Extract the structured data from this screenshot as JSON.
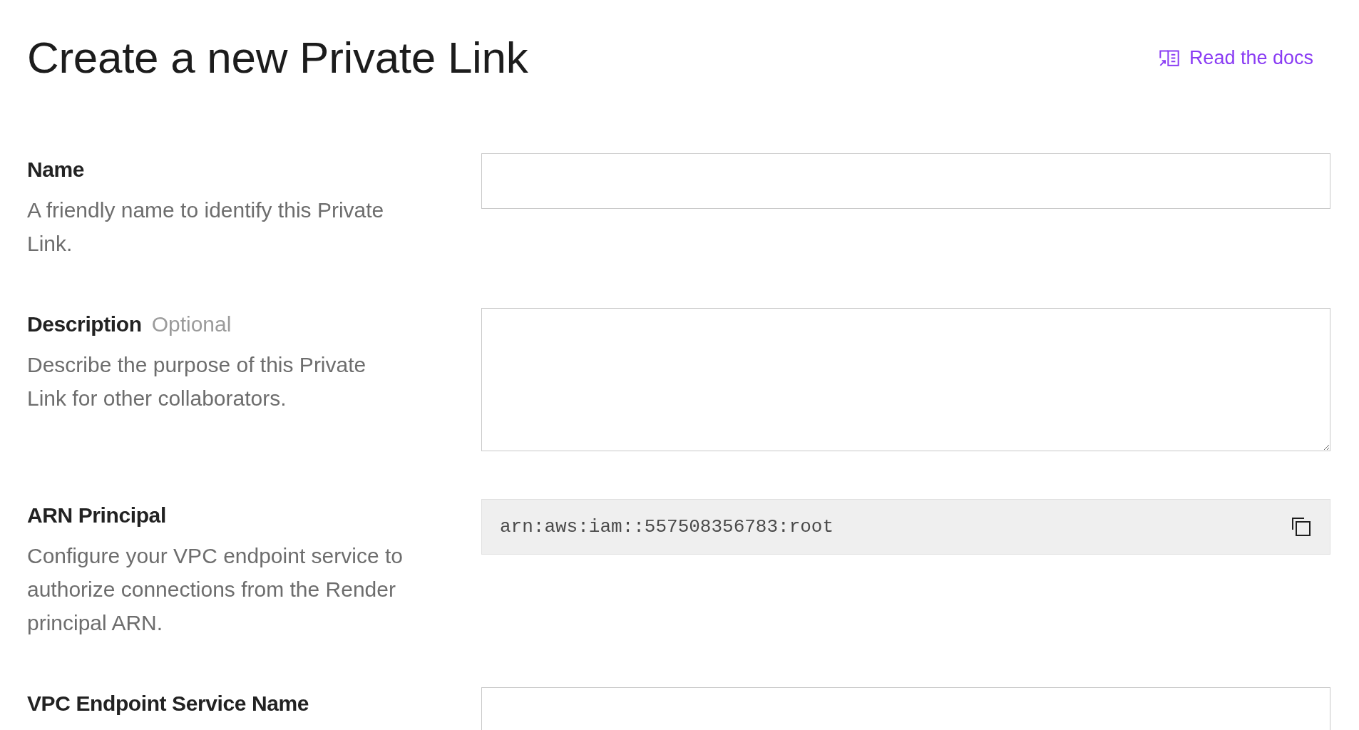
{
  "header": {
    "title": "Create a new Private Link",
    "docs_link": "Read the docs"
  },
  "fields": [
    {
      "kind": "input",
      "label": "Name",
      "description": "A friendly name to identify this Private Link."
    },
    {
      "kind": "textarea",
      "label": "Description",
      "optional_tag": "Optional",
      "description": "Describe the purpose of this Private Link for other collaborators."
    },
    {
      "kind": "copy",
      "label": "ARN Principal",
      "description": "Configure your VPC endpoint service to authorize connections from the Render principal ARN.",
      "value": "arn:aws:iam::557508356783:root"
    },
    {
      "kind": "input",
      "label": "VPC Endpoint Service Name"
    }
  ]
}
